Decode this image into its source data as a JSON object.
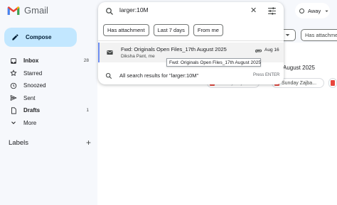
{
  "app": {
    "name": "Gmail"
  },
  "sidebar": {
    "compose_label": "Compose",
    "items": [
      {
        "label": "Inbox",
        "count": "28",
        "icon": "inbox-icon"
      },
      {
        "label": "Starred",
        "count": "",
        "icon": "star-icon"
      },
      {
        "label": "Snoozed",
        "count": "",
        "icon": "clock-icon"
      },
      {
        "label": "Sent",
        "count": "",
        "icon": "send-icon"
      },
      {
        "label": "Drafts",
        "count": "1",
        "icon": "draft-icon"
      },
      {
        "label": "More",
        "count": "",
        "icon": "chevron-down-icon"
      }
    ],
    "labels_heading": "Labels",
    "labels_add": "+"
  },
  "header": {
    "status_label": "Away"
  },
  "search": {
    "query": "larger:10M",
    "chips": [
      "Has attachment",
      "Last 7 days",
      "From me"
    ],
    "result": {
      "subject": "Fwd: Originals Open Files_17th August 2025",
      "from": "Diksha Pant, me",
      "date": "Aug 16"
    },
    "tooltip": "Fwd: Originals Open Files_17th August 2025",
    "all_results": "All search results for \"larger:10M\"",
    "enter_hint": "Press ENTER"
  },
  "background": {
    "chip_has_attachment": "Has attachment",
    "row_text": "August 2025",
    "attachment_1": "Sunday Zajba...",
    "attachment_2": "Sunday Zajba..."
  },
  "colors": {
    "compose_bg": "#c2e7ff",
    "accent": "#6e8ef2",
    "pdf": "#e8453c"
  }
}
